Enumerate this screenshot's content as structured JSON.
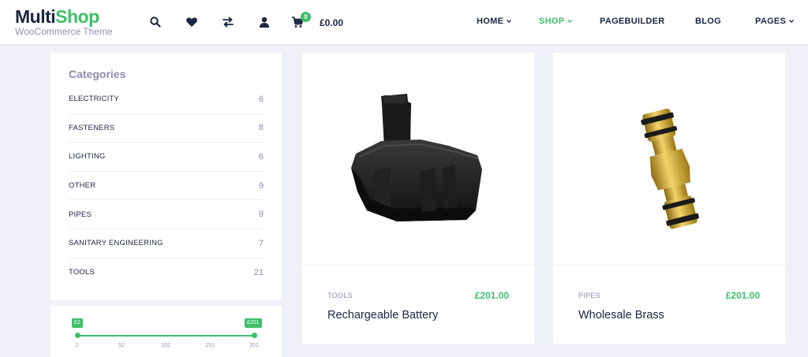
{
  "header": {
    "logo_main": "Multi",
    "logo_accent": "Shop",
    "logo_sub": "WooCommerce Theme",
    "cart_count": "0",
    "cart_total": "£0.00",
    "icons": [
      "search-icon",
      "heart-icon",
      "compare-icon",
      "user-icon",
      "cart-icon"
    ]
  },
  "nav": {
    "items": [
      {
        "label": "HOME",
        "dropdown": true,
        "active": false
      },
      {
        "label": "SHOP",
        "dropdown": true,
        "active": true
      },
      {
        "label": "PAGEBUILDER",
        "dropdown": false,
        "active": false
      },
      {
        "label": "BLOG",
        "dropdown": false,
        "active": false
      },
      {
        "label": "PAGES",
        "dropdown": true,
        "active": false
      }
    ]
  },
  "sidebar": {
    "title": "Categories",
    "categories": [
      {
        "name": "ELECTRICITY",
        "count": "6"
      },
      {
        "name": "FASTENERS",
        "count": "8"
      },
      {
        "name": "LIGHTING",
        "count": "6"
      },
      {
        "name": "OTHER",
        "count": "9"
      },
      {
        "name": "PIPES",
        "count": "9"
      },
      {
        "name": "SANITARY ENGINEERING",
        "count": "7"
      },
      {
        "name": "TOOLS",
        "count": "21"
      }
    ]
  },
  "price_filter": {
    "min_label": "£2",
    "max_label": "£201",
    "ticks": [
      "2",
      "52",
      "102",
      "151",
      "201"
    ]
  },
  "products": [
    {
      "category": "TOOLS",
      "price": "£201.00",
      "title": "Rechargeable Battery",
      "image": "battery-image"
    },
    {
      "category": "PIPES",
      "price": "£201.00",
      "title": "Wholesale Brass",
      "image": "brass-connector-image"
    }
  ],
  "colors": {
    "accent": "#3dbf6a",
    "text": "#1c2541",
    "muted": "#8c8cb0",
    "background": "#f0f0f8"
  }
}
